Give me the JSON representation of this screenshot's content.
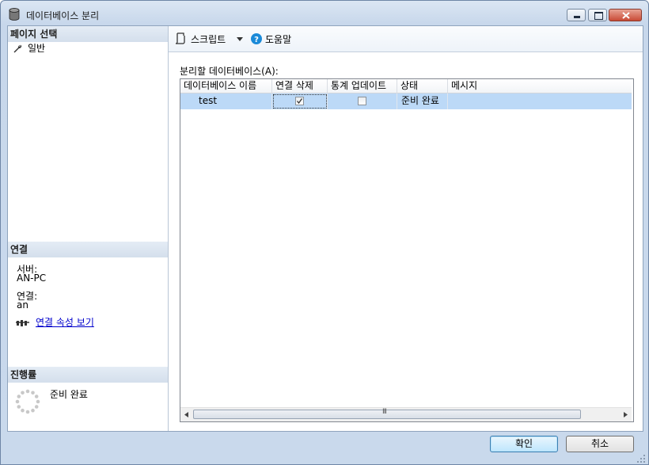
{
  "window": {
    "title": "데이터베이스 분리",
    "icons": {
      "app": "database-icon",
      "minimize": "minimize-icon",
      "maximize": "maximize-icon",
      "close": "close-icon"
    }
  },
  "left_panel": {
    "pages_header": "페이지 선택",
    "pages": [
      {
        "label": "일반",
        "icon": "wrench-icon"
      }
    ],
    "connection_header": "연결",
    "server_label": "서버:",
    "server_value": "AN-PC",
    "connection_label": "연결:",
    "connection_value": "an",
    "view_props_link": "연결 속성 보기",
    "progress_header": "진행률",
    "progress_status": "준비 완료"
  },
  "toolbar": {
    "script_label": "스크립트",
    "help_label": "도움말"
  },
  "main": {
    "grid_label": "분리할 데이터베이스(A):",
    "columns": [
      "데이터베이스 이름",
      "연결 삭제",
      "통계 업데이트",
      "상태",
      "메시지"
    ],
    "rows": [
      {
        "name": "test",
        "drop_connections": true,
        "update_statistics": false,
        "status": "준비 완료",
        "message": ""
      }
    ],
    "scroll_grip": "III"
  },
  "footer": {
    "ok_label": "확인",
    "cancel_label": "취소"
  },
  "colors": {
    "selection": "#bcd9f7",
    "link": "#0000cc",
    "help_icon": "#1b8ad8"
  }
}
